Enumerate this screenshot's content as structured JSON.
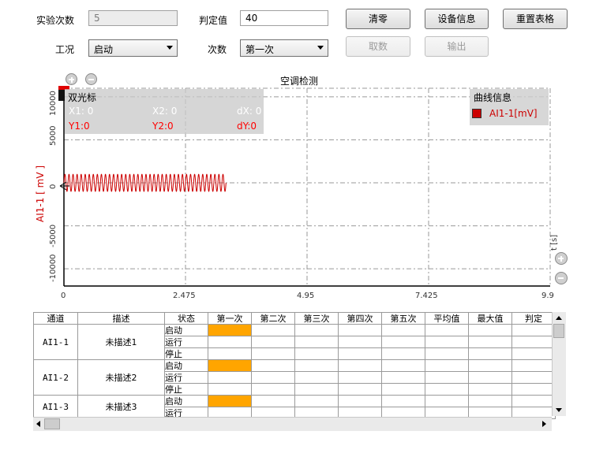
{
  "controls": {
    "test_count_label": "实验次数",
    "test_count_value": "5",
    "judge_label": "判定值",
    "judge_value": "40",
    "condition_label": "工况",
    "condition_value": "启动",
    "times_label": "次数",
    "times_value": "第一次"
  },
  "buttons": {
    "clear": "清零",
    "device_info": "设备信息",
    "reset_table": "重置表格",
    "take": "取数",
    "output": "输出"
  },
  "chart": {
    "title": "空调检测",
    "cursor_panel": {
      "title": "双光标",
      "x1": "X1: 0",
      "x2": "X2: 0",
      "dx": "dX: 0",
      "y1": "Y1:0",
      "y2": "Y2:0",
      "dy": "dY:0"
    },
    "legend_title": "曲线信息",
    "legend_item": "AI1-1[mV]",
    "x_unit_label": "t [s]",
    "colors": {
      "series": "#cc0000",
      "cursor_text": "#ff0000",
      "grid": "#9a9a9a"
    }
  },
  "chart_data": {
    "type": "line",
    "title": "空调检测",
    "xlabel": "t [s]",
    "ylabel": "AI1-1 [ mV ]",
    "xlim": [
      0,
      9.9
    ],
    "ylim": [
      -12000,
      11000
    ],
    "x_ticks": [
      "0",
      "2.475",
      "4.95",
      "7.425",
      "9.9"
    ],
    "y_ticks": [
      "10000",
      "5000",
      "0",
      "-5000",
      "-10000"
    ],
    "series": [
      {
        "name": "AI1-1[mV]",
        "signal": "sine",
        "x_start": 0,
        "x_end": 3.3,
        "amplitude": 1000,
        "cycles": 40
      }
    ],
    "grid": true,
    "legend_position": "top-right"
  },
  "table": {
    "headers": [
      "通道",
      "描述",
      "状态",
      "第一次",
      "第二次",
      "第三次",
      "第四次",
      "第五次",
      "平均值",
      "最大值",
      "判定"
    ],
    "groups": [
      {
        "channel": "AI1-1",
        "desc": "未描述1",
        "states": [
          "启动",
          "运行",
          "停止"
        ]
      },
      {
        "channel": "AI1-2",
        "desc": "未描述2",
        "states": [
          "启动",
          "运行",
          "停止"
        ]
      },
      {
        "channel": "AI1-3",
        "desc": "未描述3",
        "states": [
          "启动",
          "运行"
        ]
      }
    ]
  }
}
